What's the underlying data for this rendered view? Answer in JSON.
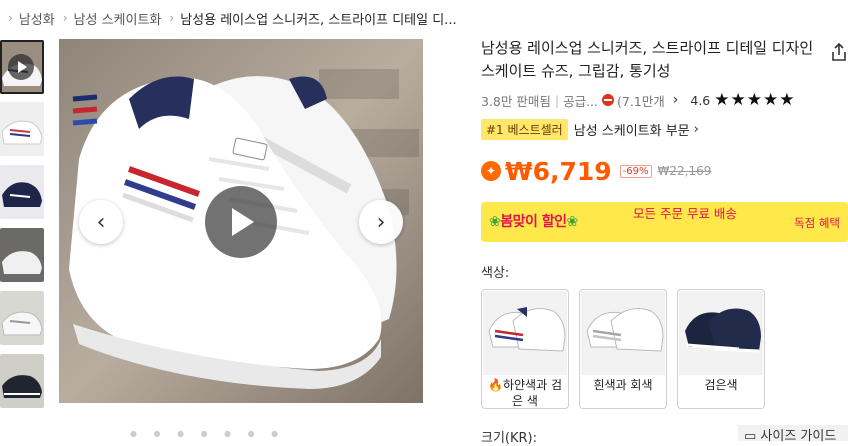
{
  "breadcrumb": [
    {
      "label": "남성화"
    },
    {
      "label": "남성 스케이트화"
    },
    {
      "label": "남성용 레이스업 스니커즈, 스트라이프 디테일 디..."
    }
  ],
  "product": {
    "title": "남성용 레이스업 스니커즈, 스트라이프 디테일 디자인 스케이트 슈즈, 그립감, 통기성",
    "sold": "3.8만 판매됨",
    "supplier": "공급...",
    "reviews": "(7.1만개",
    "rating": "4.6",
    "stars": "★★★★★",
    "best_badge": "#1 베스트셀러",
    "best_category": "남성 스케이트화 부문",
    "price": "₩6,719",
    "discount": "-69%",
    "old_price": "₩22,169"
  },
  "promo": {
    "title": "봄맞이 할인",
    "text": "모든 주문 무료 배송",
    "exclusive": "독점 혜택"
  },
  "colors": {
    "label": "색상:",
    "options": [
      {
        "label": "하얀색과 검은 색",
        "prefix_icon": "fire-icon"
      },
      {
        "label": "흰색과 회색"
      },
      {
        "label": "검은색"
      }
    ]
  },
  "size": {
    "label": "크기(KR):",
    "guide": "사이즈 가이드"
  },
  "colors_hex": {
    "price_orange": "#ff5a00",
    "promo_yellow": "#ffe94a",
    "promo_red": "#e2144b",
    "best_yellow": "#ffe76b"
  }
}
